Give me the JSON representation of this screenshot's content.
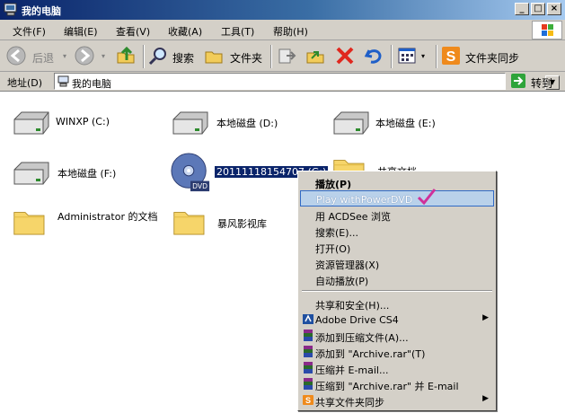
{
  "window": {
    "title": "我的电脑"
  },
  "titlebar_buttons": {
    "minimize": "_",
    "maximize": "□",
    "close": "×"
  },
  "menubar": {
    "items": [
      "文件(F)",
      "编辑(E)",
      "查看(V)",
      "收藏(A)",
      "工具(T)",
      "帮助(H)"
    ]
  },
  "toolbar": {
    "back_label": "后退",
    "search_label": "搜索",
    "folders_label": "文件夹",
    "sync_label": "文件夹同步"
  },
  "address": {
    "label": "地址(D)",
    "value": "我的电脑",
    "go_label": "转到"
  },
  "files": [
    {
      "label": "WINXP (C:)",
      "type": "hdd-icon"
    },
    {
      "label": "本地磁盘 (D:)",
      "type": "hdd-icon"
    },
    {
      "label": "本地磁盘 (E:)",
      "type": "hdd-icon"
    },
    {
      "label": "本地磁盘 (F:)",
      "type": "hdd-icon"
    },
    {
      "label": "20111118154707 (G:)",
      "type": "dvd-icon"
    },
    {
      "label": "共享文档",
      "type": "folder-icon"
    },
    {
      "label": "Administrator 的文档",
      "type": "folder-icon"
    },
    {
      "label": "暴风影视库",
      "type": "folder-icon"
    }
  ],
  "context_menu": {
    "items": [
      {
        "label": "播放(P)",
        "bold": true
      },
      {
        "label": "Play withPowerDVD",
        "highlighted": true
      },
      {
        "label": "用 ACDSee 浏览"
      },
      {
        "label": "搜索(E)..."
      },
      {
        "label": "打开(O)"
      },
      {
        "label": "资源管理器(X)"
      },
      {
        "label": "自动播放(P)"
      },
      {
        "label": "共享和安全(H)..."
      },
      {
        "label": "Adobe Drive CS4",
        "submenu": true
      },
      {
        "label": "添加到压缩文件(A)..."
      },
      {
        "label": "添加到 \"Archive.rar\"(T)"
      },
      {
        "label": "压缩并 E-mail..."
      },
      {
        "label": "压缩到 \"Archive.rar\" 并 E-mail"
      },
      {
        "label": "共享文件夹同步",
        "submenu": true
      }
    ]
  },
  "colors": {
    "selection": "#0a246a",
    "menu_bg": "#d4d0c8",
    "checkmark": "#d0309a"
  }
}
